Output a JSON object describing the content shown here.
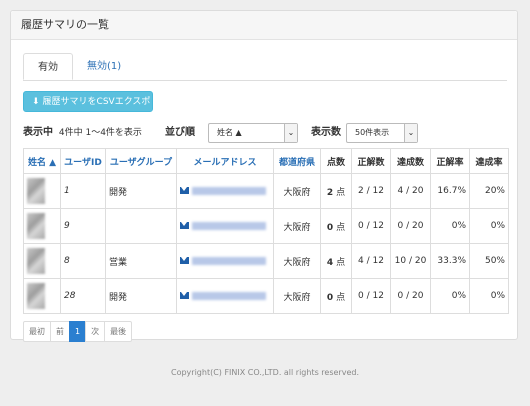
{
  "panel": {
    "title": "履歴サマリの一覧"
  },
  "tabs": [
    {
      "label": "有効",
      "active": true
    },
    {
      "label": "無効(1)",
      "active": false
    }
  ],
  "export_button": {
    "label": "履歴サマリをCSVエクスポート",
    "icon": "download-icon"
  },
  "status": {
    "label": "表示中",
    "summary": "4件中 1〜4件を表示",
    "sort_label": "並び順",
    "sort_value": "姓名 ▲",
    "count_label": "表示数",
    "count_value": "50件表示"
  },
  "table": {
    "headers": [
      "姓名 ▲",
      "ユーザID",
      "ユーザグループ",
      "メールアドレス",
      "都道府県",
      "点数",
      "正解数",
      "達成数",
      "正解率",
      "達成率"
    ],
    "rows": [
      {
        "uid": "1",
        "group": "開発",
        "pref": "大阪府",
        "score_num": "2",
        "score_unit": "点",
        "correct": "2 / 12",
        "achieved": "4 / 20",
        "correct_rate": "16.7%",
        "achieve_rate": "20%"
      },
      {
        "uid": "9",
        "group": "",
        "pref": "大阪府",
        "score_num": "0",
        "score_unit": "点",
        "correct": "0 / 12",
        "achieved": "0 / 20",
        "correct_rate": "0%",
        "achieve_rate": "0%"
      },
      {
        "uid": "8",
        "group": "営業",
        "pref": "大阪府",
        "score_num": "4",
        "score_unit": "点",
        "correct": "4 / 12",
        "achieved": "10 / 20",
        "correct_rate": "33.3%",
        "achieve_rate": "50%"
      },
      {
        "uid": "28",
        "group": "開発",
        "pref": "大阪府",
        "score_num": "0",
        "score_unit": "点",
        "correct": "0 / 12",
        "achieved": "0 / 20",
        "correct_rate": "0%",
        "achieve_rate": "0%"
      }
    ]
  },
  "pagination": {
    "first": "最初",
    "prev": "前",
    "current": "1",
    "next": "次",
    "last": "最後"
  },
  "footer": {
    "copyright": "Copyright(C) FINIX CO.,LTD. all rights reserved."
  },
  "colors": {
    "link": "#2a6fb5",
    "info_button": "#5bc0de",
    "page_active": "#2a7fd0"
  }
}
